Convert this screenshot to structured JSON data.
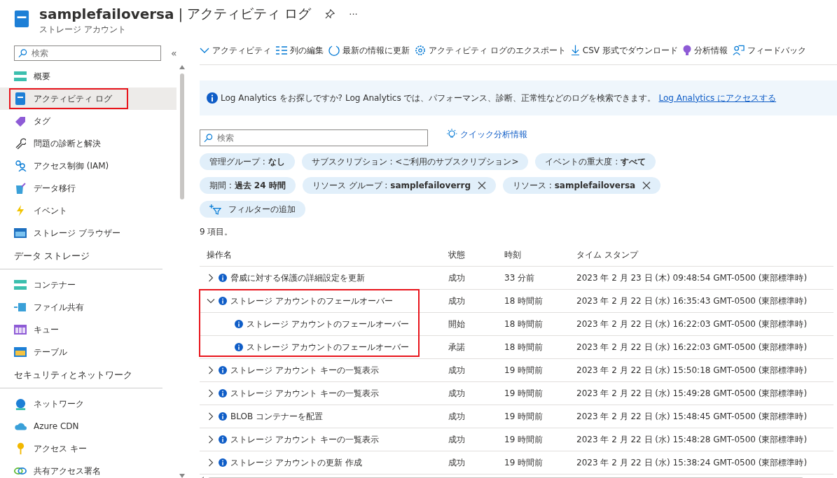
{
  "header": {
    "resource_name": "samplefailoversa",
    "separator": "|",
    "page_name": "アクティビティ ログ",
    "subtitle": "ストレージ アカウント",
    "more": "···"
  },
  "sidebar": {
    "search": {
      "placeholder": "検索"
    },
    "collapse": "«",
    "items": [
      {
        "kind": "item",
        "label": "概要",
        "selected": false,
        "highlighted": false
      },
      {
        "kind": "item",
        "label": "アクティビティ ログ",
        "selected": true,
        "highlighted": true
      },
      {
        "kind": "item",
        "label": "タグ",
        "selected": false,
        "highlighted": false
      },
      {
        "kind": "item",
        "label": "問題の診断と解決",
        "selected": false,
        "highlighted": false
      },
      {
        "kind": "item",
        "label": "アクセス制御 (IAM)",
        "selected": false,
        "highlighted": false
      },
      {
        "kind": "item",
        "label": "データ移行",
        "selected": false,
        "highlighted": false
      },
      {
        "kind": "item",
        "label": "イベント",
        "selected": false,
        "highlighted": false
      },
      {
        "kind": "item",
        "label": "ストレージ ブラウザー",
        "selected": false,
        "highlighted": false
      },
      {
        "kind": "section",
        "label": "データ ストレージ"
      },
      {
        "kind": "item",
        "label": "コンテナー",
        "selected": false,
        "highlighted": false
      },
      {
        "kind": "item",
        "label": "ファイル共有",
        "selected": false,
        "highlighted": false
      },
      {
        "kind": "item",
        "label": "キュー",
        "selected": false,
        "highlighted": false
      },
      {
        "kind": "item",
        "label": "テーブル",
        "selected": false,
        "highlighted": false
      },
      {
        "kind": "section",
        "label": "セキュリティとネットワーク"
      },
      {
        "kind": "item",
        "label": "ネットワーク",
        "selected": false,
        "highlighted": false
      },
      {
        "kind": "item",
        "label": "Azure CDN",
        "selected": false,
        "highlighted": false
      },
      {
        "kind": "item",
        "label": "アクセス キー",
        "selected": false,
        "highlighted": false
      },
      {
        "kind": "item",
        "label": "共有アクセス署名",
        "selected": false,
        "highlighted": false
      }
    ]
  },
  "toolbar": [
    "アクティビティ",
    "列の編集",
    "最新の情報に更新",
    "アクティビティ ログのエクスポート",
    "CSV 形式でダウンロード",
    "分析情報",
    "フィードバック"
  ],
  "banner": {
    "title": "Log Analytics をお探しですか?",
    "text": "Log Analytics では、パフォーマンス、診断、正常性などのログを検索できます。",
    "link": "Log Analytics にアクセスする"
  },
  "search": {
    "placeholder": "検索"
  },
  "quick_insights": "クイック分析情報",
  "filters": [
    {
      "kind": "filter",
      "text": "管理グループ : **なし**",
      "removable": false
    },
    {
      "kind": "filter",
      "text": "サブスクリプション :  <ご利用のサブスクリプション>",
      "removable": false
    },
    {
      "kind": "filter",
      "text": "イベントの重大度 : **すべて**",
      "removable": false
    },
    {
      "kind": "filter",
      "text": "期間 : **過去 24 時間**",
      "removable": false
    },
    {
      "kind": "filter",
      "text": "リソース グループ : **samplefailoverrg**",
      "removable": true
    },
    {
      "kind": "filter",
      "text": "リソース : **samplefailoversa**",
      "removable": true
    },
    {
      "kind": "add",
      "text": "フィルターの追加"
    }
  ],
  "item_count": "9 項目。",
  "table": {
    "columns": [
      "操作名",
      "状態",
      "時刻",
      "タイム スタンプ"
    ],
    "rows": [
      {
        "name": "脅威に対する保護の詳細設定を更新",
        "status": "成功",
        "time": "33 分前",
        "timestamp": "2023 年 2 月 23 日 (木) 09:48:54 GMT-0500 (東部標準時)",
        "expanded": false,
        "highlighted": false
      },
      {
        "name": "ストレージ アカウントのフェールオーバー",
        "status": "成功",
        "time": "18 時間前",
        "timestamp": "2023 年 2 月 22 日 (水) 16:35:43 GMT-0500 (東部標準時)",
        "expanded": true,
        "highlighted": true,
        "children": [
          {
            "name": "ストレージ アカウントのフェールオーバー",
            "status": "開始",
            "time": "18 時間前",
            "timestamp": "2023 年 2 月 22 日 (水) 16:22:03 GMT-0500 (東部標準時)"
          },
          {
            "name": "ストレージ アカウントのフェールオーバー",
            "status": "承諾",
            "time": "18 時間前",
            "timestamp": "2023 年 2 月 22 日 (水) 16:22:03 GMT-0500 (東部標準時)"
          }
        ]
      },
      {
        "name": "ストレージ アカウント キーの一覧表示",
        "status": "成功",
        "time": "19 時間前",
        "timestamp": "2023 年 2 月 22 日 (水) 15:50:18 GMT-0500 (東部標準時)",
        "expanded": false,
        "highlighted": false
      },
      {
        "name": "ストレージ アカウント キーの一覧表示",
        "status": "成功",
        "time": "19 時間前",
        "timestamp": "2023 年 2 月 22 日 (水) 15:49:28 GMT-0500 (東部標準時)",
        "expanded": false,
        "highlighted": false
      },
      {
        "name": "BLOB コンテナーを配置",
        "status": "成功",
        "time": "19 時間前",
        "timestamp": "2023 年 2 月 22 日 (水) 15:48:45 GMT-0500 (東部標準時)",
        "expanded": false,
        "highlighted": false
      },
      {
        "name": "ストレージ アカウント キーの一覧表示",
        "status": "成功",
        "time": "19 時間前",
        "timestamp": "2023 年 2 月 22 日 (水) 15:48:28 GMT-0500 (東部標準時)",
        "expanded": false,
        "highlighted": false
      },
      {
        "name": "ストレージ アカウントの更新 作成",
        "status": "成功",
        "time": "19 時間前",
        "timestamp": "2023 年 2 月 22 日 (水) 15:38:24 GMT-0500 (東部標準時)",
        "expanded": false,
        "highlighted": false
      }
    ]
  }
}
